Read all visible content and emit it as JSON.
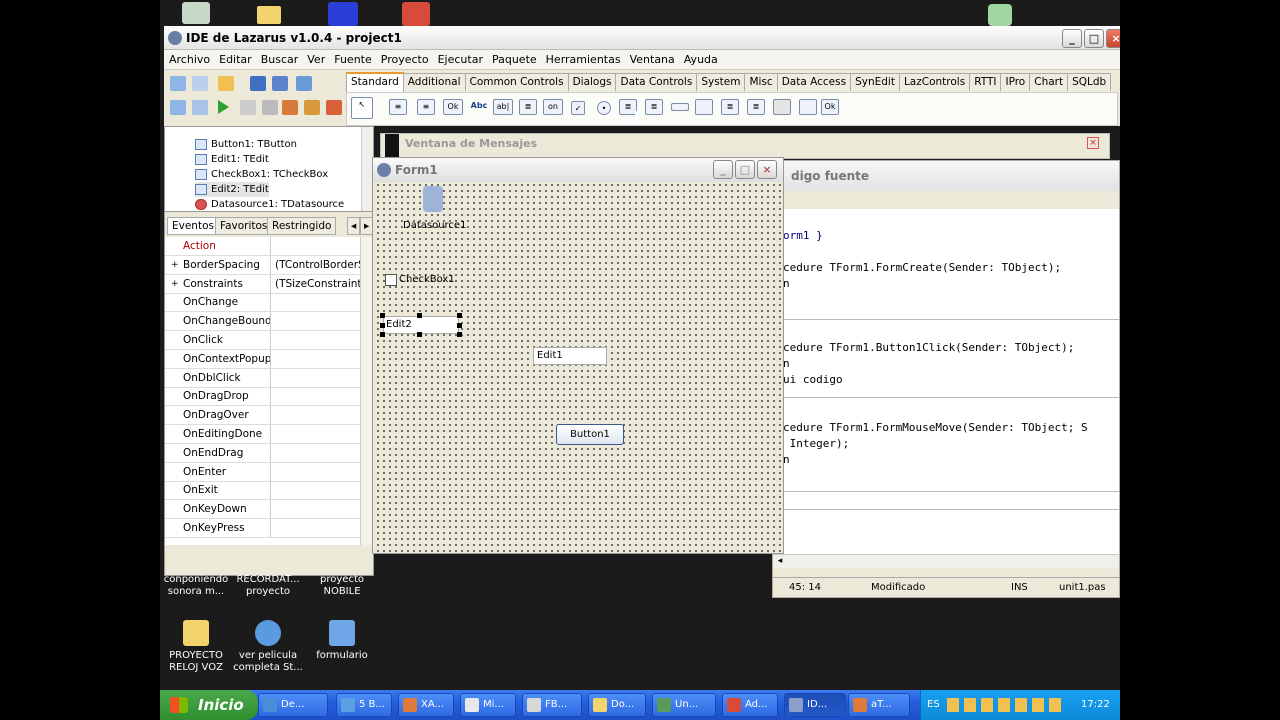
{
  "desktop": {
    "top_icons": [
      "",
      "",
      "",
      "",
      ""
    ],
    "icons": [
      {
        "label": "conponiendo sonora m...",
        "color": "#c9a36a"
      },
      {
        "label": "RECORDAT... proyecto",
        "color": "#c9a36a"
      },
      {
        "label": "proyecto NOBILE",
        "color": "#c9a36a"
      },
      {
        "label": "PROYECTO RELOJ VOZ",
        "color": "#f3d36b"
      },
      {
        "label": "ver pelicula completa St...",
        "color": "#5a9be0"
      },
      {
        "label": "formulario",
        "color": "#6fa6e8"
      }
    ]
  },
  "ide": {
    "title": "IDE de Lazarus v1.0.4 - project1",
    "menu": [
      "Archivo",
      "Editar",
      "Buscar",
      "Ver",
      "Fuente",
      "Proyecto",
      "Ejecutar",
      "Paquete",
      "Herramientas",
      "Ventana",
      "Ayuda"
    ],
    "palette_tabs": [
      "Standard",
      "Additional",
      "Common Controls",
      "Dialogs",
      "Data Controls",
      "System",
      "Misc",
      "Data Access",
      "SynEdit",
      "LazControls",
      "RTTI",
      "IPro",
      "Chart",
      "SQLdb"
    ],
    "active_tab": "Standard"
  },
  "inspector": {
    "tree": [
      "Button1: TButton",
      "Edit1: TEdit",
      "CheckBox1: TCheckBox",
      "Edit2: TEdit",
      "Datasource1: TDatasource"
    ],
    "tabs": [
      "Eventos",
      "Favoritos",
      "Restringido"
    ],
    "props": [
      {
        "name": "Action",
        "value": "",
        "plus": ""
      },
      {
        "name": "BorderSpacing",
        "value": "(TControlBorderSp",
        "plus": "+"
      },
      {
        "name": "Constraints",
        "value": "(TSizeConstraints)",
        "plus": "+"
      },
      {
        "name": "OnChange",
        "value": "",
        "plus": ""
      },
      {
        "name": "OnChangeBounds",
        "value": "",
        "plus": ""
      },
      {
        "name": "OnClick",
        "value": "",
        "plus": ""
      },
      {
        "name": "OnContextPopup",
        "value": "",
        "plus": ""
      },
      {
        "name": "OnDblClick",
        "value": "",
        "plus": ""
      },
      {
        "name": "OnDragDrop",
        "value": "",
        "plus": ""
      },
      {
        "name": "OnDragOver",
        "value": "",
        "plus": ""
      },
      {
        "name": "OnEditingDone",
        "value": "",
        "plus": ""
      },
      {
        "name": "OnEndDrag",
        "value": "",
        "plus": ""
      },
      {
        "name": "OnEnter",
        "value": "",
        "plus": ""
      },
      {
        "name": "OnExit",
        "value": "",
        "plus": ""
      },
      {
        "name": "OnKeyDown",
        "value": "",
        "plus": ""
      },
      {
        "name": "OnKeyPress",
        "value": "",
        "plus": ""
      }
    ]
  },
  "messages": {
    "title": "Ventana de Mensajes"
  },
  "form1": {
    "title": "Form1",
    "datasource": "Datasource1",
    "checkbox": "CheckBox1",
    "edit2": "Edit2",
    "edit1": "Edit1",
    "button1": "Button1"
  },
  "source": {
    "title": "digo fuente",
    "lines": [
      {
        "t": "orm1 }",
        "c": "cm"
      },
      {
        "t": "cedure TForm1.FormCreate(Sender: TObject);",
        "c": ""
      },
      {
        "t": "n",
        "c": ""
      },
      {
        "t": "cedure TForm1.Button1Click(Sender: TObject);",
        "c": ""
      },
      {
        "t": "n",
        "c": ""
      },
      {
        "t": "ui codigo",
        "c": ""
      },
      {
        "t": "cedure TForm1.FormMouseMove(Sender: TObject; S",
        "c": ""
      },
      {
        "t": " Integer);",
        "c": ""
      },
      {
        "t": "n",
        "c": ""
      }
    ],
    "status": {
      "pos": "45: 14",
      "state": "Modificado",
      "mode": "INS",
      "file": "unit1.pas"
    }
  },
  "taskbar": {
    "start": "Inicio",
    "tasks": [
      "De...",
      "5 B...",
      "XA...",
      "Mi...",
      "FB...",
      "Do...",
      "Un...",
      "Ad...",
      "ID...",
      "aT..."
    ],
    "lang": "ES",
    "clock": "17:22"
  }
}
